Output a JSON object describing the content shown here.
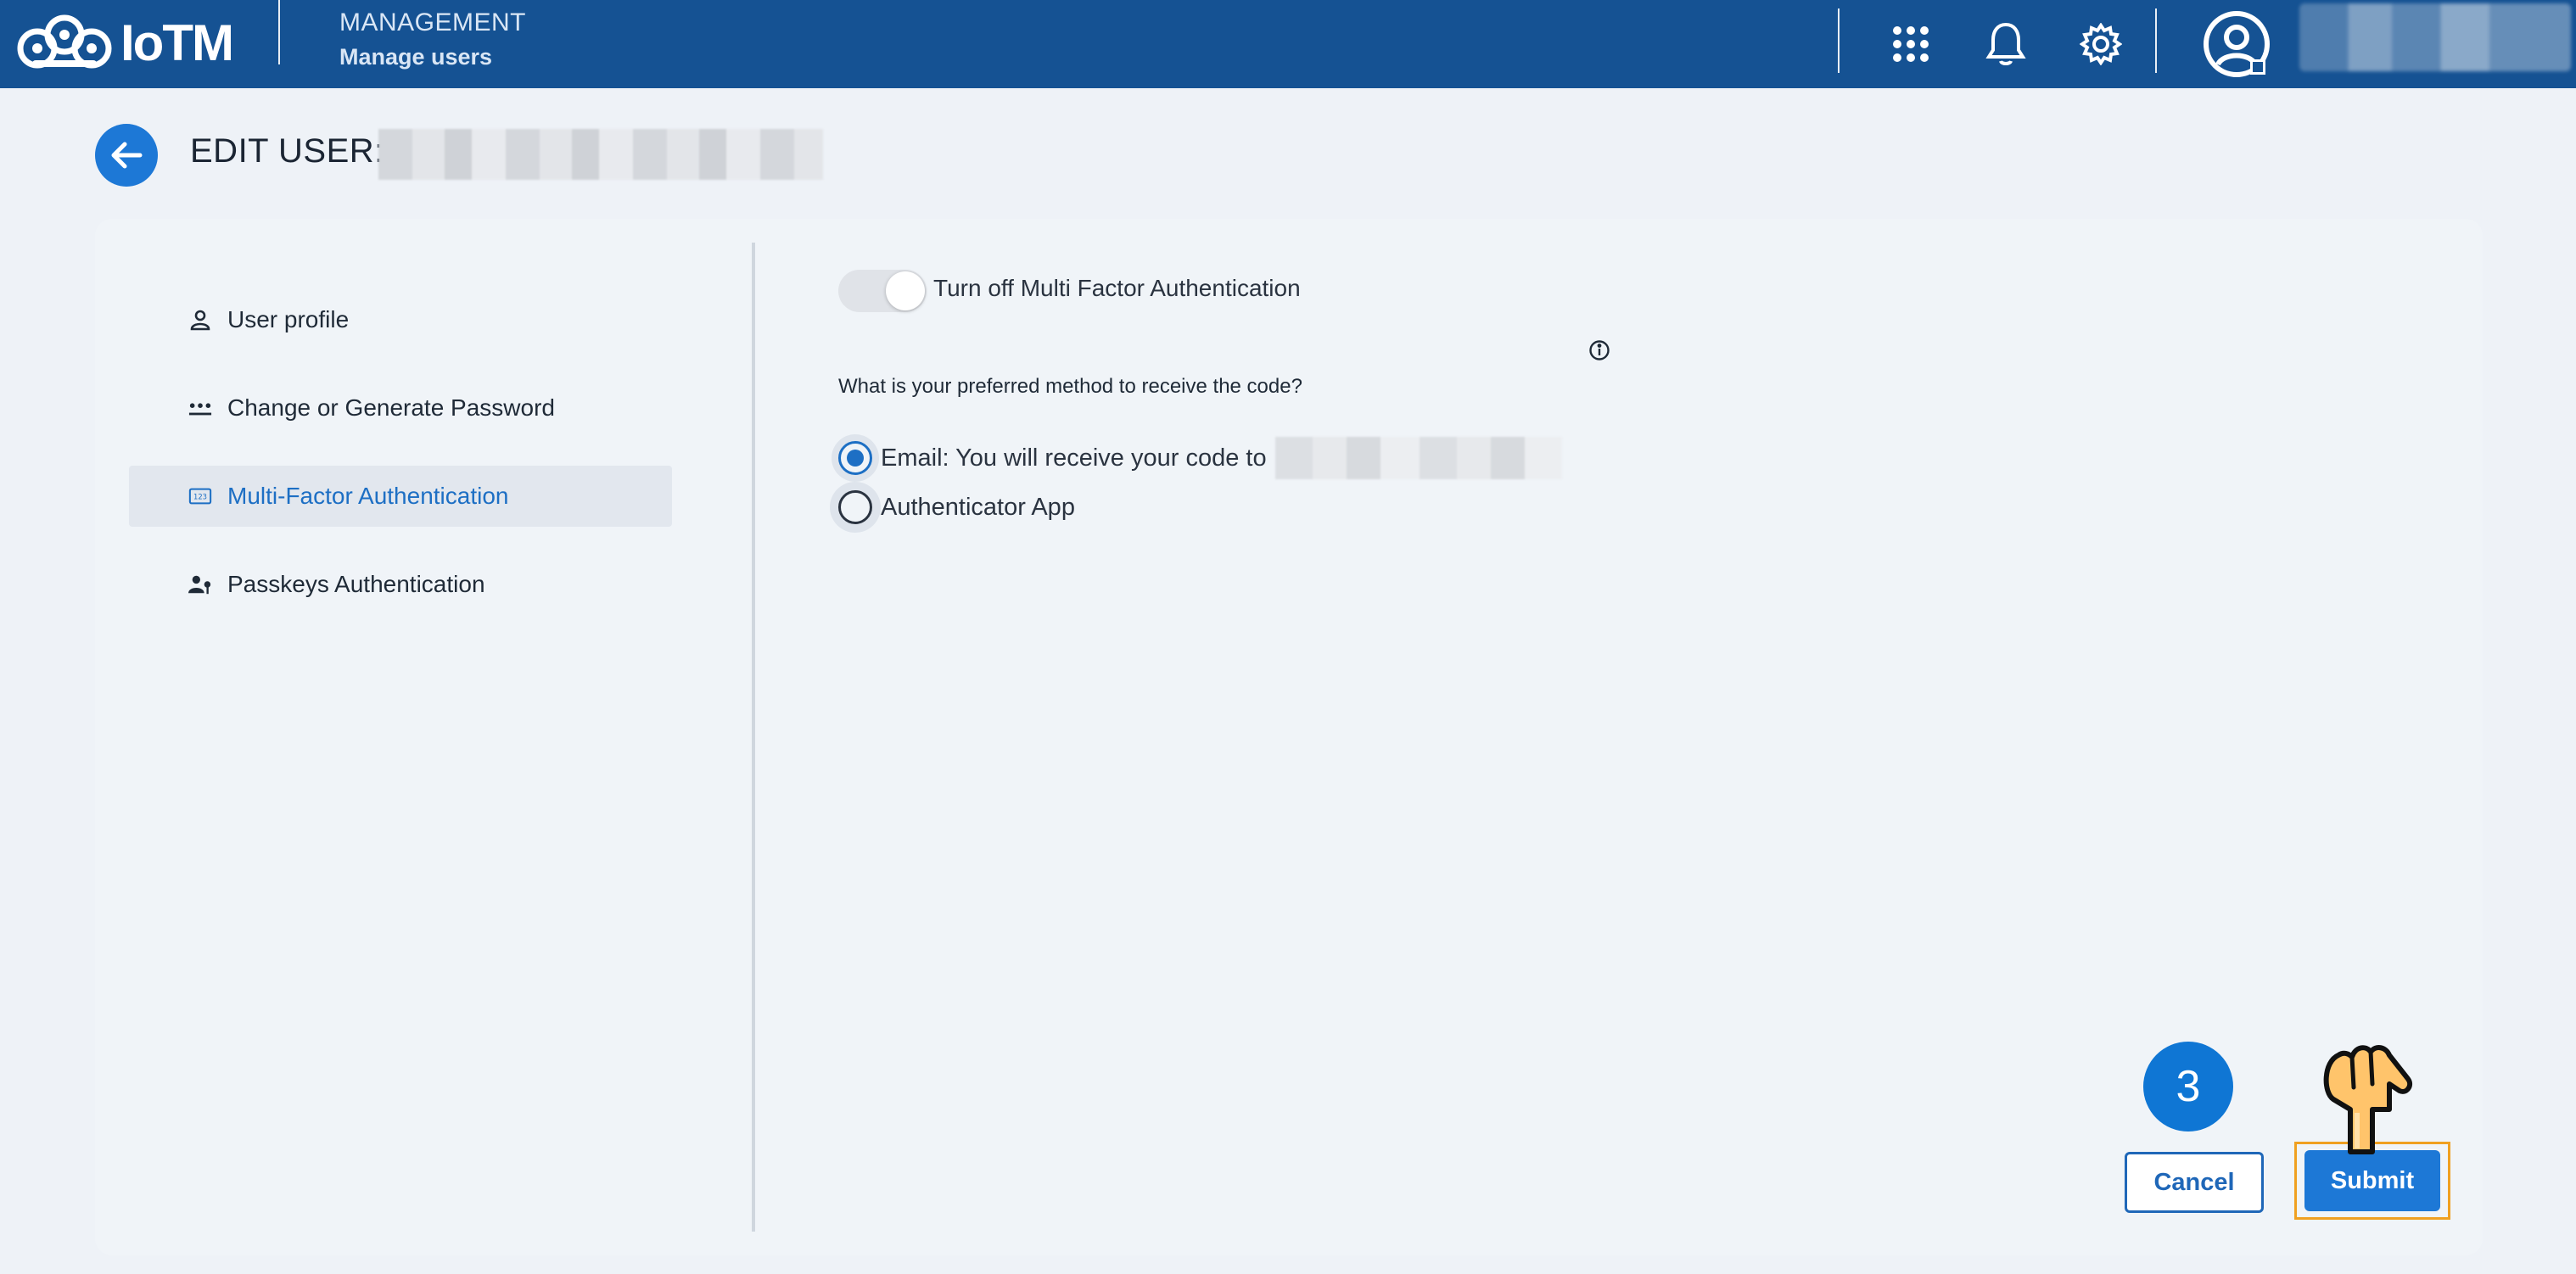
{
  "topbar": {
    "logo_text": "IoTM",
    "module_title": "MANAGEMENT",
    "module_subtitle": "Manage users",
    "icons": [
      "apps-grid-icon",
      "bell-icon",
      "gear-icon",
      "user-avatar-icon"
    ]
  },
  "header": {
    "title": "EDIT USER:"
  },
  "sidebar": {
    "items": [
      {
        "label": "User profile",
        "icon": "person-icon",
        "active": false
      },
      {
        "label": "Change or Generate Password",
        "icon": "password-dots-icon",
        "active": false
      },
      {
        "label": "Multi-Factor Authentication",
        "icon": "code-123-icon",
        "active": true
      },
      {
        "label": "Passkeys Authentication",
        "icon": "person-key-icon",
        "active": false
      }
    ]
  },
  "mfa": {
    "toggle_label": "Turn off Multi Factor Authentication",
    "question": "What is your preferred method to receive the code?",
    "options": [
      {
        "label": "Email: You will receive your code to",
        "selected": true
      },
      {
        "label": "Authenticator App",
        "selected": false
      }
    ]
  },
  "actions": {
    "cancel_label": "Cancel",
    "submit_label": "Submit",
    "step_number": "3"
  },
  "colors": {
    "topbar": "#155293",
    "accent": "#1d78d6",
    "active_nav_text": "#1d6fc4",
    "highlight": "#f0a020"
  }
}
